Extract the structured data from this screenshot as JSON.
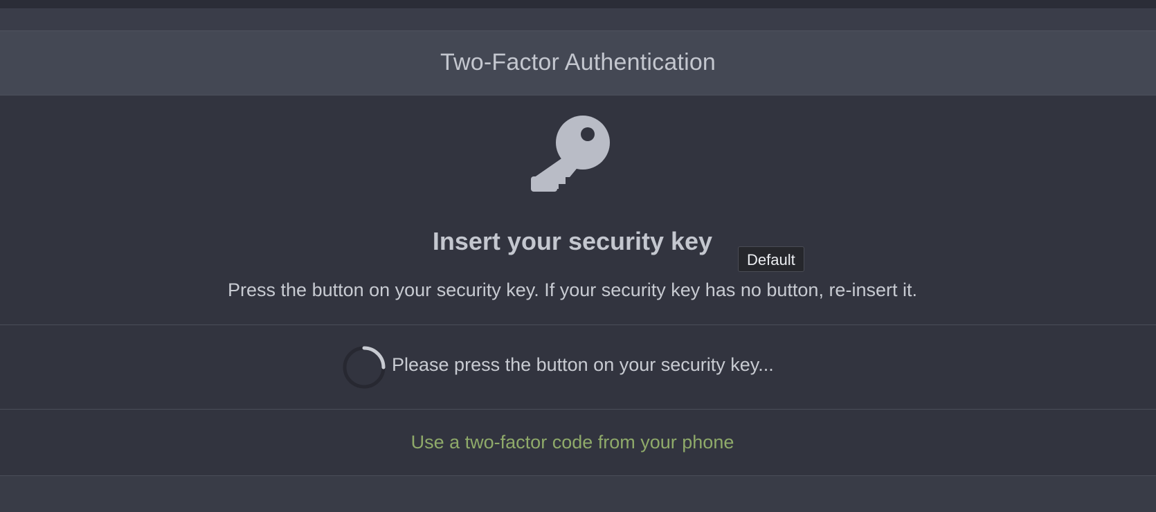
{
  "dialog": {
    "title": "Two-Factor Authentication"
  },
  "prompt": {
    "icon": "key-icon",
    "title": "Insert your security key",
    "description": "Press the button on your security key. If your security key has no button, re-insert it."
  },
  "tooltip": {
    "text": "Default"
  },
  "status": {
    "icon": "loading-spinner-icon",
    "text": "Please press the button on your security key..."
  },
  "alternative": {
    "link_text": "Use a two-factor code from your phone"
  },
  "colors": {
    "background": "#32343f",
    "header": "#444854",
    "text": "#c8cbd2",
    "link": "#8faa6a"
  }
}
